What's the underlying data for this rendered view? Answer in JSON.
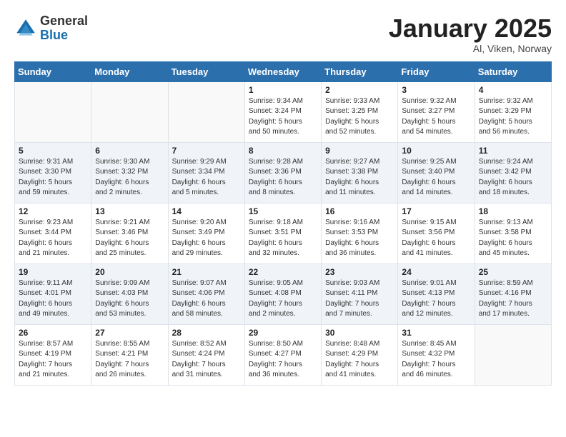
{
  "header": {
    "logo": {
      "general": "General",
      "blue": "Blue"
    },
    "title": "January 2025",
    "subtitle": "Al, Viken, Norway"
  },
  "weekdays": [
    "Sunday",
    "Monday",
    "Tuesday",
    "Wednesday",
    "Thursday",
    "Friday",
    "Saturday"
  ],
  "weeks": [
    [
      {
        "day": "",
        "info": ""
      },
      {
        "day": "",
        "info": ""
      },
      {
        "day": "",
        "info": ""
      },
      {
        "day": "1",
        "info": "Sunrise: 9:34 AM\nSunset: 3:24 PM\nDaylight: 5 hours\nand 50 minutes."
      },
      {
        "day": "2",
        "info": "Sunrise: 9:33 AM\nSunset: 3:25 PM\nDaylight: 5 hours\nand 52 minutes."
      },
      {
        "day": "3",
        "info": "Sunrise: 9:32 AM\nSunset: 3:27 PM\nDaylight: 5 hours\nand 54 minutes."
      },
      {
        "day": "4",
        "info": "Sunrise: 9:32 AM\nSunset: 3:29 PM\nDaylight: 5 hours\nand 56 minutes."
      }
    ],
    [
      {
        "day": "5",
        "info": "Sunrise: 9:31 AM\nSunset: 3:30 PM\nDaylight: 5 hours\nand 59 minutes."
      },
      {
        "day": "6",
        "info": "Sunrise: 9:30 AM\nSunset: 3:32 PM\nDaylight: 6 hours\nand 2 minutes."
      },
      {
        "day": "7",
        "info": "Sunrise: 9:29 AM\nSunset: 3:34 PM\nDaylight: 6 hours\nand 5 minutes."
      },
      {
        "day": "8",
        "info": "Sunrise: 9:28 AM\nSunset: 3:36 PM\nDaylight: 6 hours\nand 8 minutes."
      },
      {
        "day": "9",
        "info": "Sunrise: 9:27 AM\nSunset: 3:38 PM\nDaylight: 6 hours\nand 11 minutes."
      },
      {
        "day": "10",
        "info": "Sunrise: 9:25 AM\nSunset: 3:40 PM\nDaylight: 6 hours\nand 14 minutes."
      },
      {
        "day": "11",
        "info": "Sunrise: 9:24 AM\nSunset: 3:42 PM\nDaylight: 6 hours\nand 18 minutes."
      }
    ],
    [
      {
        "day": "12",
        "info": "Sunrise: 9:23 AM\nSunset: 3:44 PM\nDaylight: 6 hours\nand 21 minutes."
      },
      {
        "day": "13",
        "info": "Sunrise: 9:21 AM\nSunset: 3:46 PM\nDaylight: 6 hours\nand 25 minutes."
      },
      {
        "day": "14",
        "info": "Sunrise: 9:20 AM\nSunset: 3:49 PM\nDaylight: 6 hours\nand 29 minutes."
      },
      {
        "day": "15",
        "info": "Sunrise: 9:18 AM\nSunset: 3:51 PM\nDaylight: 6 hours\nand 32 minutes."
      },
      {
        "day": "16",
        "info": "Sunrise: 9:16 AM\nSunset: 3:53 PM\nDaylight: 6 hours\nand 36 minutes."
      },
      {
        "day": "17",
        "info": "Sunrise: 9:15 AM\nSunset: 3:56 PM\nDaylight: 6 hours\nand 41 minutes."
      },
      {
        "day": "18",
        "info": "Sunrise: 9:13 AM\nSunset: 3:58 PM\nDaylight: 6 hours\nand 45 minutes."
      }
    ],
    [
      {
        "day": "19",
        "info": "Sunrise: 9:11 AM\nSunset: 4:01 PM\nDaylight: 6 hours\nand 49 minutes."
      },
      {
        "day": "20",
        "info": "Sunrise: 9:09 AM\nSunset: 4:03 PM\nDaylight: 6 hours\nand 53 minutes."
      },
      {
        "day": "21",
        "info": "Sunrise: 9:07 AM\nSunset: 4:06 PM\nDaylight: 6 hours\nand 58 minutes."
      },
      {
        "day": "22",
        "info": "Sunrise: 9:05 AM\nSunset: 4:08 PM\nDaylight: 7 hours\nand 2 minutes."
      },
      {
        "day": "23",
        "info": "Sunrise: 9:03 AM\nSunset: 4:11 PM\nDaylight: 7 hours\nand 7 minutes."
      },
      {
        "day": "24",
        "info": "Sunrise: 9:01 AM\nSunset: 4:13 PM\nDaylight: 7 hours\nand 12 minutes."
      },
      {
        "day": "25",
        "info": "Sunrise: 8:59 AM\nSunset: 4:16 PM\nDaylight: 7 hours\nand 17 minutes."
      }
    ],
    [
      {
        "day": "26",
        "info": "Sunrise: 8:57 AM\nSunset: 4:19 PM\nDaylight: 7 hours\nand 21 minutes."
      },
      {
        "day": "27",
        "info": "Sunrise: 8:55 AM\nSunset: 4:21 PM\nDaylight: 7 hours\nand 26 minutes."
      },
      {
        "day": "28",
        "info": "Sunrise: 8:52 AM\nSunset: 4:24 PM\nDaylight: 7 hours\nand 31 minutes."
      },
      {
        "day": "29",
        "info": "Sunrise: 8:50 AM\nSunset: 4:27 PM\nDaylight: 7 hours\nand 36 minutes."
      },
      {
        "day": "30",
        "info": "Sunrise: 8:48 AM\nSunset: 4:29 PM\nDaylight: 7 hours\nand 41 minutes."
      },
      {
        "day": "31",
        "info": "Sunrise: 8:45 AM\nSunset: 4:32 PM\nDaylight: 7 hours\nand 46 minutes."
      },
      {
        "day": "",
        "info": ""
      }
    ]
  ]
}
